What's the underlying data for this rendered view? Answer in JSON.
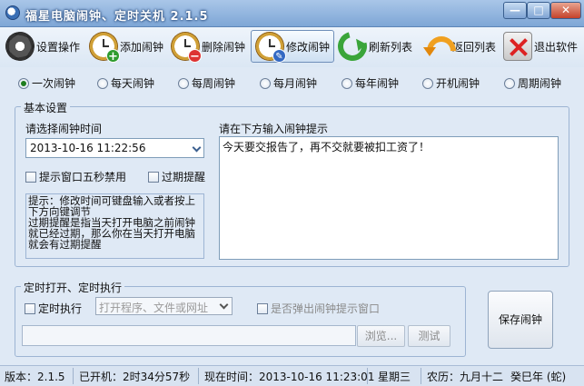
{
  "window": {
    "title": "福星电脑闹钟、定时关机 2.1.5",
    "minimize": "—",
    "maximize": "□",
    "close": "✕"
  },
  "toolbar": {
    "items": [
      {
        "label": "设置操作",
        "icon": "gear-icon"
      },
      {
        "label": "添加闹钟",
        "icon": "alarm-add-icon"
      },
      {
        "label": "删除闹钟",
        "icon": "alarm-delete-icon"
      },
      {
        "label": "修改闹钟",
        "icon": "alarm-edit-icon",
        "active": true
      },
      {
        "label": "刷新列表",
        "icon": "refresh-icon"
      },
      {
        "label": "返回列表",
        "icon": "back-arrow-icon"
      },
      {
        "label": "退出软件",
        "icon": "exit-icon"
      }
    ]
  },
  "frequency": {
    "options": [
      "一次闹钟",
      "每天闹钟",
      "每周闹钟",
      "每月闹钟",
      "每年闹钟",
      "开机闹钟",
      "周期闹钟"
    ],
    "selected": "一次闹钟"
  },
  "basic": {
    "group_title": "基本设置",
    "time_label": "请选择闹钟时间",
    "time_value": "2013-10-16 11:22:56",
    "disable_popup_label": "提示窗口五秒禁用",
    "expired_remind_label": "过期提醒",
    "tip": "提示：修改时间可键盘输入或者按上下方向键调节\n过期提醒是指当天打开电脑之前闹钟就已经过期，那么你在当天打开电脑就会有过期提醒",
    "message_label": "请在下方输入闹钟提示",
    "message_value": "今天要交报告了，再不交就要被扣工资了！"
  },
  "scheduled": {
    "group_title": "定时打开、定时执行",
    "execute_label": "定时执行",
    "target_placeholder": "打开程序、文件或网址",
    "popup_label": "是否弹出闹钟提示窗口",
    "browse_label": "浏览...",
    "test_label": "测试"
  },
  "save_label": "保存闹钟",
  "status": {
    "version": "版本：2.1.5",
    "uptime": "已开机：2时34分57秒",
    "now": "现在时间：2013-10-16 11:23:01",
    "weekday": "星期三",
    "lunar": "农历：九月十二",
    "year": "癸巳年 (蛇)"
  }
}
